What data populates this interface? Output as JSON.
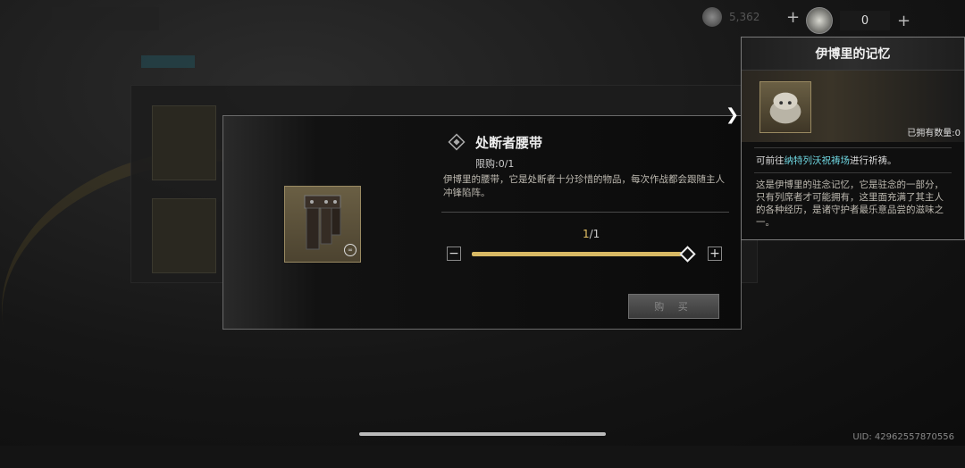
{
  "currency": {
    "gold_value": "5,362",
    "special_value": "0"
  },
  "item": {
    "title": "处断者腰带",
    "limit": "限购:0/1",
    "description": "伊博里的腰带，它是处断者十分珍惜的物品，每次作战都会跟随主人冲锋陷阵。",
    "qty_current": "1",
    "qty_total": "/1",
    "qty_fraction": 1.0,
    "buy_label": "购 买"
  },
  "tooltip": {
    "title": "伊博里的记忆",
    "owned": "已拥有数量:0",
    "go_prefix": "可前往",
    "go_place": "纳特列沃祝祷场",
    "go_suffix": "进行祈祷。",
    "description": "这是伊博里的驻念记忆，它是驻念的一部分，只有列席者才可能拥有，这里面充满了其主人的各种经历，是诸守护者最乐意品尝的滋味之一。"
  },
  "uid": "UID: 42962557870556",
  "icons": {
    "coin": "silver-coin-icon",
    "special": "stone-coin-icon",
    "title": "diamond-rune-icon",
    "badge": "bound-badge-icon",
    "expand": "chevron-right-icon"
  },
  "colors": {
    "accent_gold": "#d8b964",
    "highlight_cyan": "#6ed6e0"
  }
}
